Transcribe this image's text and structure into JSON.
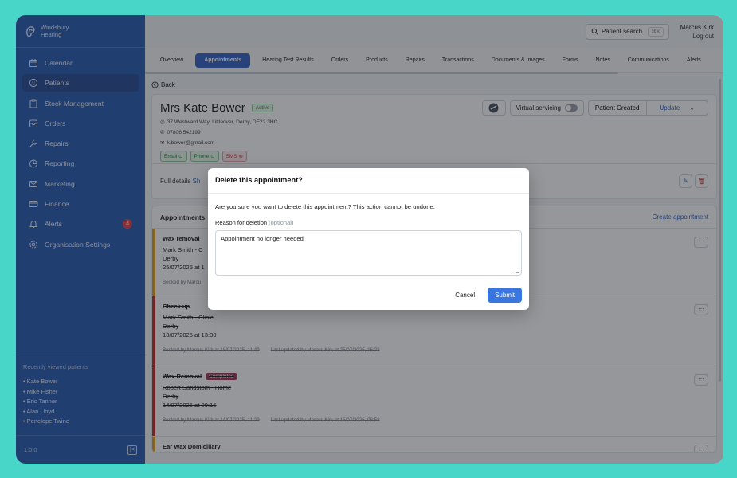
{
  "brand": {
    "name": "Windsbury",
    "sub": "Hearing"
  },
  "sidebar": {
    "items": [
      {
        "label": "Calendar",
        "icon": "calendar-icon"
      },
      {
        "label": "Patients",
        "icon": "smile-icon",
        "active": true
      },
      {
        "label": "Stock Management",
        "icon": "clipboard-icon"
      },
      {
        "label": "Orders",
        "icon": "inbox-icon"
      },
      {
        "label": "Repairs",
        "icon": "wrench-icon"
      },
      {
        "label": "Reporting",
        "icon": "pie-chart-icon"
      },
      {
        "label": "Marketing",
        "icon": "mail-icon"
      },
      {
        "label": "Finance",
        "icon": "credit-card-icon"
      },
      {
        "label": "Alerts",
        "icon": "bell-icon",
        "badge": "3"
      },
      {
        "label": "Organisation Settings",
        "icon": "gear-icon"
      }
    ],
    "recent_title": "Recently viewed patients",
    "recent": [
      "• Kate Bower",
      "• Mike Fisher",
      "• Eric Tanner",
      "• Alan Lloyd",
      "• Penelope Twine"
    ],
    "version": "1.0.0"
  },
  "topbar": {
    "search_label": "Patient search",
    "search_shortcut": "⌘K",
    "user_name": "Marcus Kirk",
    "logout": "Log out"
  },
  "tabs": [
    "Overview",
    "Appointments",
    "Hearing Test Results",
    "Orders",
    "Products",
    "Repairs",
    "Transactions",
    "Documents & Images",
    "Forms",
    "Notes",
    "Communications",
    "Alerts"
  ],
  "active_tab": "Appointments",
  "back_label": "Back",
  "patient": {
    "name": "Mrs Kate Bower",
    "status": "Active",
    "address": "37 Westward Way, Littleover, Derby, DE22 3HC",
    "phone": "07806 542199",
    "email": "k.bower@gmail.com",
    "chips": [
      {
        "label": "Email ⊙",
        "ok": true
      },
      {
        "label": "Phone ⊙",
        "ok": true
      },
      {
        "label": "SMS ⊗",
        "ok": false
      }
    ],
    "virtual_servicing": "Virtual servicing",
    "patient_created": "Patient Created",
    "update": "Update",
    "full_details": "Full details",
    "show": "Sh"
  },
  "appointments": {
    "title": "Appointments",
    "create": "Create appointment",
    "list": [
      {
        "title": "Wax removal",
        "lines": [
          "Mark Smith - C",
          "Derby",
          "25/07/2025 at 1"
        ],
        "meta": [
          "Booked by Marcu"
        ],
        "color": "#e0a020",
        "struck": false
      },
      {
        "title": "Check up",
        "lines": [
          "Mark Smith - Clinic",
          "Derby",
          "18/07/2025 at 13:30"
        ],
        "meta": [
          "Booked by Marcus Kirk at 18/07/2025, 11:49",
          "Last updated by Marcus Kirk at 25/07/2025, 16:23"
        ],
        "color": "#c43030",
        "struck": true
      },
      {
        "title": "Wax Removal",
        "badge": "Completed",
        "lines": [
          "Robert Sandstom - Home",
          "Derby",
          "14/07/2025 at 09:15"
        ],
        "meta": [
          "Booked by Marcus Kirk at 14/07/2025, 11:29",
          "Last updated by Marcus Kirk at 15/07/2025, 08:58"
        ],
        "color": "#c43030",
        "struck": true
      },
      {
        "title": "Ear Wax Domiciliary",
        "lines": [],
        "meta": [],
        "color": "#e0a020",
        "struck": false
      }
    ]
  },
  "modal": {
    "title": "Delete this appointment?",
    "message": "Are you sure you want to delete this appointment? This action cannot be undone.",
    "reason_label": "Reason for deletion",
    "reason_optional": "(optional)",
    "reason_value": "Appointment no longer needed",
    "cancel": "Cancel",
    "submit": "Submit"
  }
}
